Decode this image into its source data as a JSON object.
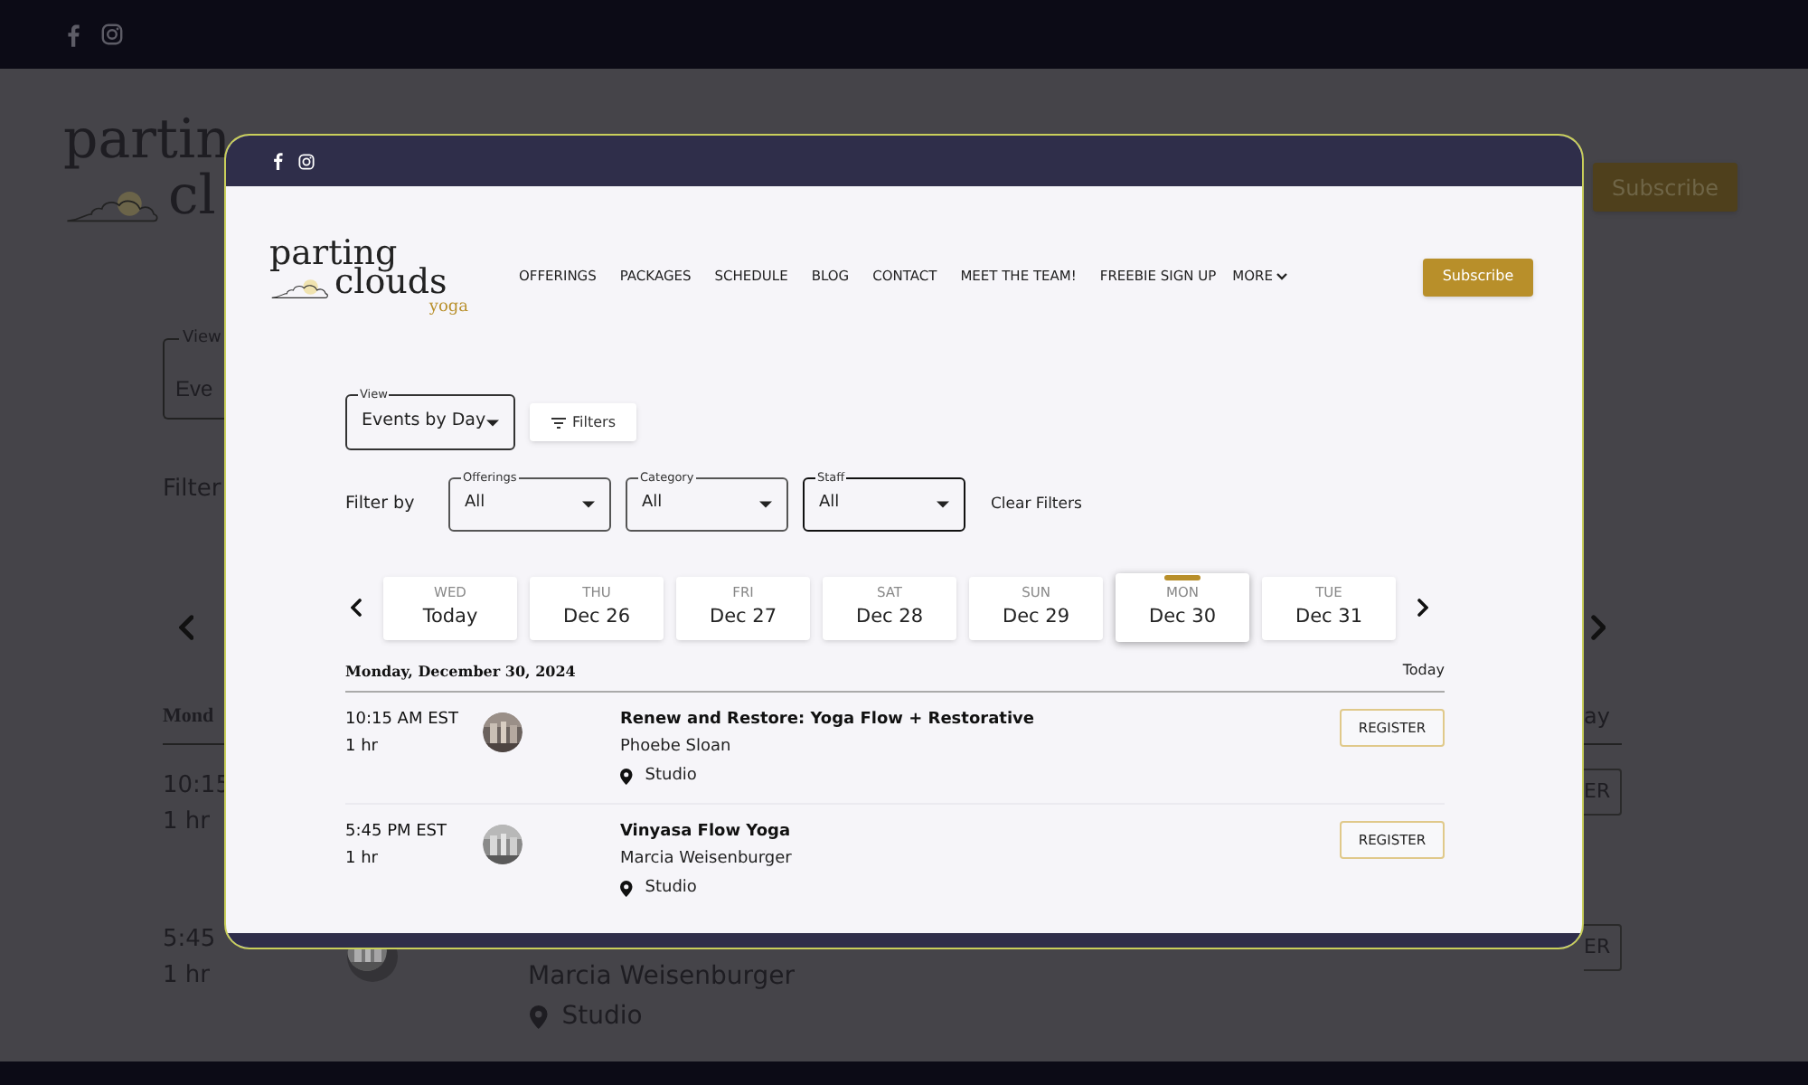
{
  "background_page": {
    "logo_fragments": [
      "partin",
      "cl"
    ],
    "subscribe_button": "Subscribe",
    "view_label": "View",
    "view_value_fragment": "Eve",
    "filter_label_fragment": "Filter",
    "day_heading_fragment": "Mond",
    "today_fragment": "ay",
    "event_fragments": [
      {
        "time": "10:15",
        "duration": "1 hr",
        "register_fragment": "ER"
      },
      {
        "time": "5:45",
        "duration": "1 hr",
        "register_fragment": "ER",
        "instructor": "Marcia Weisenburger",
        "location": "Studio"
      }
    ]
  },
  "preview": {
    "logo": {
      "line_1": "parting",
      "line_2": "clouds",
      "line_3": "yoga"
    },
    "nav": [
      "OFFERINGS",
      "PACKAGES",
      "SCHEDULE",
      "BLOG",
      "CONTACT",
      "MEET THE TEAM!",
      "FREEBIE SIGN UP"
    ],
    "more_menu": "MORE",
    "subscribe_button": "Subscribe",
    "view_select": {
      "label": "View",
      "value": "Events by Day"
    },
    "filters_button": "Filters",
    "filter_by_label": "Filter by",
    "filters": [
      {
        "label": "Offerings",
        "value": "All",
        "focused": false
      },
      {
        "label": "Category",
        "value": "All",
        "focused": false
      },
      {
        "label": "Staff",
        "value": "All",
        "focused": true
      }
    ],
    "clear_filters": "Clear Filters",
    "days": [
      {
        "weekday": "WED",
        "date": "Today",
        "selected": false
      },
      {
        "weekday": "THU",
        "date": "Dec 26",
        "selected": false
      },
      {
        "weekday": "FRI",
        "date": "Dec 27",
        "selected": false
      },
      {
        "weekday": "SAT",
        "date": "Dec 28",
        "selected": false
      },
      {
        "weekday": "SUN",
        "date": "Dec 29",
        "selected": false
      },
      {
        "weekday": "MON",
        "date": "Dec 30",
        "selected": true
      },
      {
        "weekday": "TUE",
        "date": "Dec 31",
        "selected": false
      }
    ],
    "day_heading": "Monday, December 30, 2024",
    "today_link": "Today",
    "events": [
      {
        "time": "10:15 AM EST",
        "duration": "1 hr",
        "title": "Renew and Restore: Yoga Flow + Restorative",
        "instructor": "Phoebe Sloan",
        "location": "Studio",
        "register_button": "REGISTER"
      },
      {
        "time": "5:45 PM EST",
        "duration": "1 hr",
        "title": "Vinyasa Flow Yoga",
        "instructor": "Marcia Weisenburger",
        "location": "Studio",
        "register_button": "REGISTER"
      }
    ]
  }
}
